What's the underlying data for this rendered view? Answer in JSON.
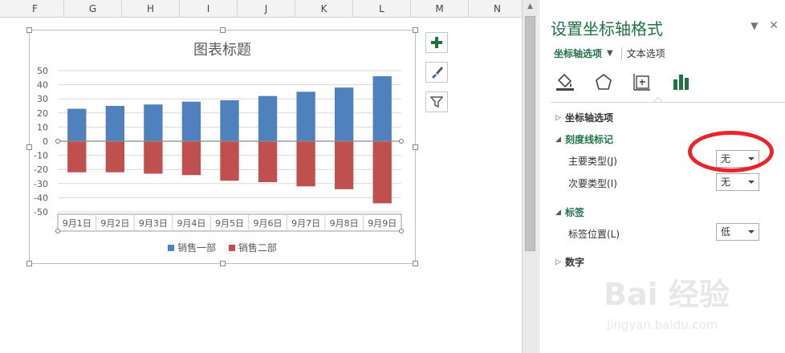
{
  "sheet": {
    "columns": [
      "F",
      "G",
      "H",
      "I",
      "J",
      "K",
      "L",
      "M",
      "N"
    ]
  },
  "chart_buttons": [
    {
      "name": "chart-elements-button",
      "icon": "plus-icon"
    },
    {
      "name": "chart-styles-button",
      "icon": "brush-icon"
    },
    {
      "name": "chart-filters-button",
      "icon": "filter-icon"
    }
  ],
  "chart_data": {
    "type": "bar",
    "title": "图表标题",
    "categories": [
      "9月1日",
      "9月2日",
      "9月3日",
      "9月4日",
      "9月5日",
      "9月6日",
      "9月7日",
      "9月8日",
      "9月9日"
    ],
    "series": [
      {
        "name": "销售一部",
        "color": "#4f81bd",
        "values": [
          23,
          25,
          26,
          28,
          29,
          32,
          35,
          38,
          46
        ]
      },
      {
        "name": "销售二部",
        "color": "#c0504d",
        "values": [
          -22,
          -22,
          -23,
          -24,
          -28,
          -29,
          -32,
          -34,
          -44
        ]
      }
    ],
    "ylim": [
      -50,
      50
    ],
    "yticks": [
      50,
      40,
      30,
      20,
      10,
      0,
      -10,
      -20,
      -30,
      -40,
      -50
    ],
    "grid": true,
    "legend": "bottom",
    "stacked": true
  },
  "pane": {
    "title": "设置坐标轴格式",
    "tabs": {
      "axis_options": "坐标轴选项",
      "text_options": "文本选项"
    },
    "icons": [
      "fill-line-icon",
      "effects-pentagon-icon",
      "size-properties-icon",
      "axis-options-bar-icon"
    ],
    "sections": {
      "axis_options": "坐标轴选项",
      "tick_marks": "刻度线标记",
      "labels": "标签",
      "number": "数字"
    },
    "fields": {
      "major_type_label": "主要类型(J)",
      "major_type_value": "无",
      "minor_type_label": "次要类型(I)",
      "minor_type_value": "无",
      "label_position_label": "标签位置(L)",
      "label_position_value": "低"
    }
  },
  "watermark": {
    "logo": "Bai 经验",
    "url": "jingyan.baidu.com"
  }
}
